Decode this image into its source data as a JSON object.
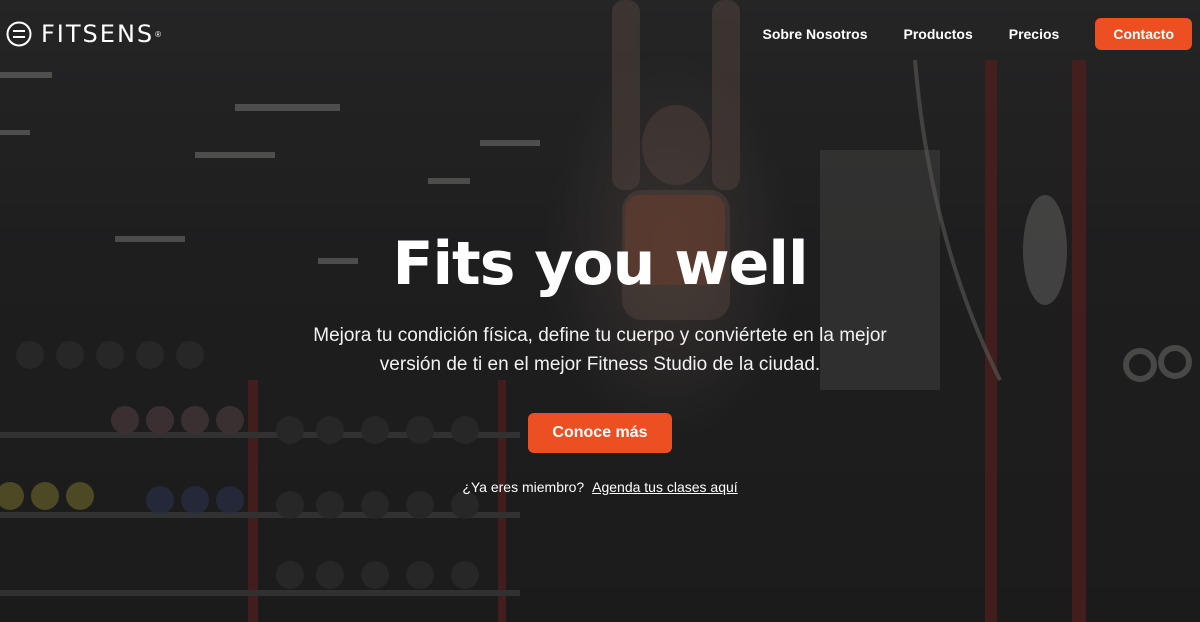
{
  "brand": {
    "name": "FITSENS",
    "registered": "®"
  },
  "nav": {
    "links": [
      "Sobre Nosotros",
      "Productos",
      "Precios"
    ],
    "cta": "Contacto"
  },
  "hero": {
    "headline": "Fits you well",
    "subtext": "Mejora tu condición física, define tu cuerpo y conviértete en la mejor versión de ti en el mejor Fitness Studio de la ciudad.",
    "cta": "Conoce más",
    "member_prompt": "¿Ya eres miembro?",
    "member_link": "Agenda tus clases aquí"
  },
  "colors": {
    "accent": "#ec4f22",
    "text": "#ffffff"
  },
  "background_image": "gym-background-photo"
}
